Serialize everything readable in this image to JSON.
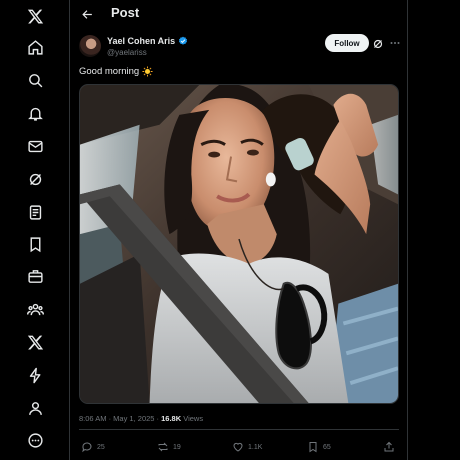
{
  "header": {
    "title": "Post"
  },
  "sidebar": {
    "items": [
      {
        "name": "x-logo-icon"
      },
      {
        "name": "home-icon"
      },
      {
        "name": "search-icon"
      },
      {
        "name": "notifications-icon"
      },
      {
        "name": "messages-icon"
      },
      {
        "name": "grok-icon"
      },
      {
        "name": "lists-icon"
      },
      {
        "name": "bookmarks-icon"
      },
      {
        "name": "jobs-icon"
      },
      {
        "name": "communities-icon"
      },
      {
        "name": "premium-icon"
      },
      {
        "name": "verified-orgs-icon"
      },
      {
        "name": "profile-icon"
      },
      {
        "name": "more-icon"
      }
    ]
  },
  "post": {
    "author_name": "Yael Cohen Aris",
    "handle": "@yaelariss",
    "follow_label": "Follow",
    "text": "Good morning",
    "emoji": "sun-emoji",
    "time": "8:06 AM · May 1, 2025 · ",
    "views_count": "16.8K",
    "views_label": " Views",
    "media_description_icon": "photo-selfie-in-car"
  },
  "actions": {
    "replies": "25",
    "reposts": "19",
    "likes": "1.1K",
    "bookmarks": "65"
  },
  "colors": {
    "background": "#000000",
    "text": "#e7e9ea",
    "secondary": "#71767b",
    "border": "#2f3336",
    "verified": "#1d9bf0",
    "follow_bg": "#eff3f4"
  }
}
